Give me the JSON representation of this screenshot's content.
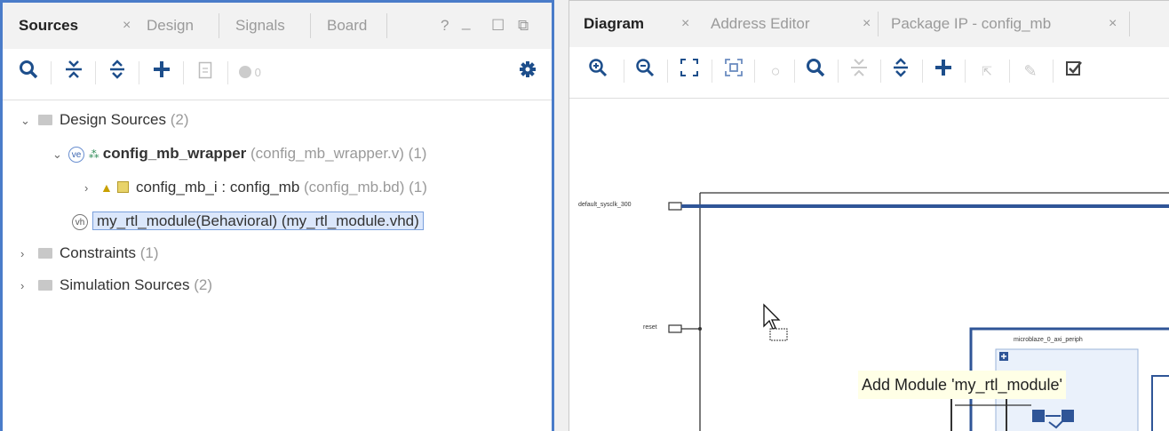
{
  "sources_panel": {
    "tabs": [
      {
        "label": "Sources",
        "close": "×",
        "active": true
      },
      {
        "label": "Design",
        "active": false
      },
      {
        "label": "Signals",
        "active": false
      },
      {
        "label": "Board",
        "active": false
      }
    ],
    "window_controls": {
      "help": "?",
      "minimize": "_",
      "maximize": "☐",
      "float": "⧉"
    },
    "toolbar": {
      "search_icon": "search-icon",
      "collapse_icon": "collapse-all-icon",
      "expand_icon": "expand-all-icon",
      "add_icon": "add-icon",
      "props_icon": "properties-icon",
      "warning_count": "0",
      "settings_icon": "gear-icon"
    },
    "tree": {
      "design_sources": {
        "label": "Design Sources",
        "count": "(2)"
      },
      "wrapper": {
        "badge": "ve",
        "name": "config_mb_wrapper",
        "file": "(config_mb_wrapper.v)",
        "count": "(1)"
      },
      "inst": {
        "name": "config_mb_i : config_mb",
        "file": "(config_mb.bd)",
        "count": "(1)"
      },
      "rtl": {
        "badge": "vh",
        "label": "my_rtl_module(Behavioral) (my_rtl_module.vhd)"
      },
      "constraints": {
        "label": "Constraints",
        "count": "(1)"
      },
      "simulation": {
        "label": "Simulation Sources",
        "count": "(2)"
      }
    }
  },
  "diagram_panel": {
    "tabs": [
      {
        "label": "Diagram",
        "close": "×",
        "active": true
      },
      {
        "label": "Address Editor",
        "close": "×",
        "active": false
      },
      {
        "label": "Package IP - config_mb",
        "close": "×",
        "active": false
      }
    ],
    "ports": {
      "clock": "default_sysclk_300",
      "reset": "reset"
    },
    "block_title": "microblaze_0_axi_periph",
    "tooltip": "Add Module 'my_rtl_module'",
    "colors": {
      "wire": "#2f5597",
      "selection_border": "#4a7cc9",
      "tooltip_bg": "#ffffe6"
    }
  }
}
